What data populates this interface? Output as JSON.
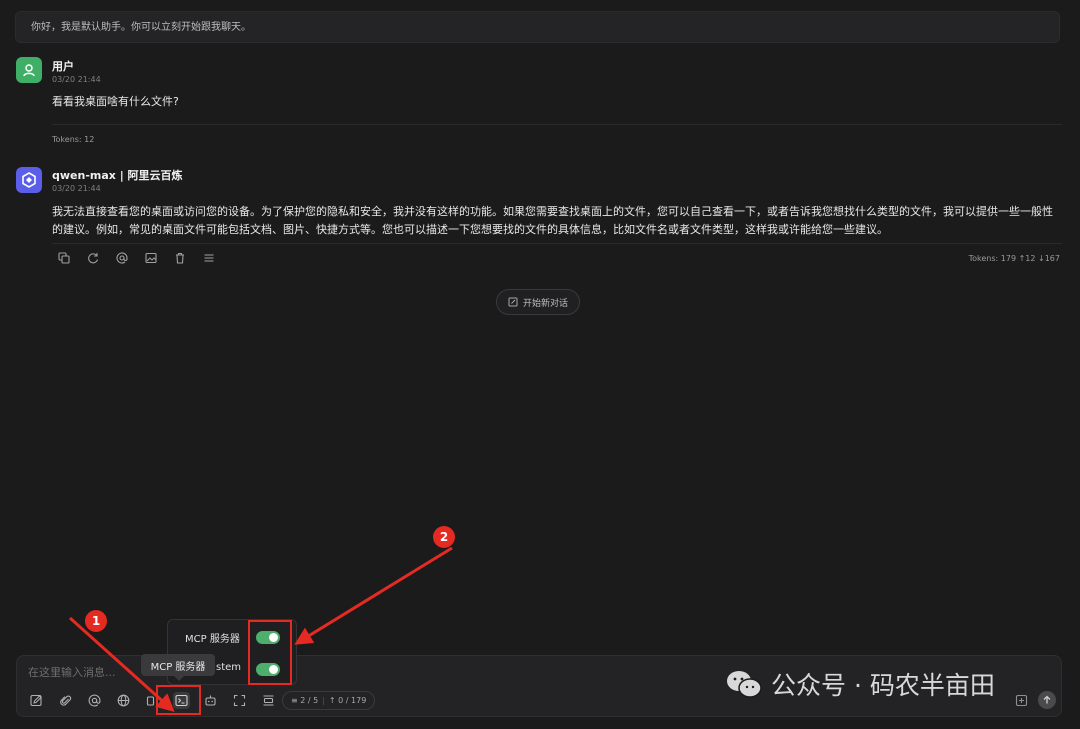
{
  "system_message": "你好，我是默认助手。你可以立刻开始跟我聊天。",
  "user_message": {
    "name": "用户",
    "time": "03/20 21:44",
    "text": "看看我桌面啥有什么文件?",
    "tokens": "Tokens: 12"
  },
  "bot_message": {
    "name": "qwen-max | 阿里云百炼",
    "time": "03/20 21:44",
    "text": "我无法直接查看您的桌面或访问您的设备。为了保护您的隐私和安全，我并没有这样的功能。如果您需要查找桌面上的文件，您可以自己查看一下，或者告诉我您想找什么类型的文件，我可以提供一些一般性的建议。例如，常见的桌面文件可能包括文档、图片、快捷方式等。您也可以描述一下您想要找的文件的具体信息，比如文件名或者文件类型，这样我或许能给您一些建议。",
    "tokens": "Tokens: 179 ↑12 ↓167",
    "actions": [
      "copy-icon",
      "refresh-icon",
      "mention-icon",
      "image-icon",
      "trash-icon",
      "menu-icon"
    ]
  },
  "new_chat_label": "开始新对话",
  "input": {
    "placeholder": "在这里输入消息..."
  },
  "toolbar": {
    "icons": [
      "edit-icon",
      "paperclip-icon",
      "at-icon",
      "globe-icon",
      "block-icon",
      "terminal-icon",
      "robot-icon",
      "expand-icon",
      "align-icon"
    ],
    "counter_left": "≡ 2 / 5",
    "counter_right": "↑ 0 / 179"
  },
  "mcp_popup": {
    "rows": [
      {
        "label": "MCP 服务器",
        "enabled": true
      },
      {
        "label": "stem",
        "enabled": true
      }
    ]
  },
  "tooltip": "MCP 服务器",
  "annotations": {
    "badge1": "1",
    "badge2": "2",
    "color": "#e52a22"
  },
  "watermark": "公众号 · 码农半亩田"
}
